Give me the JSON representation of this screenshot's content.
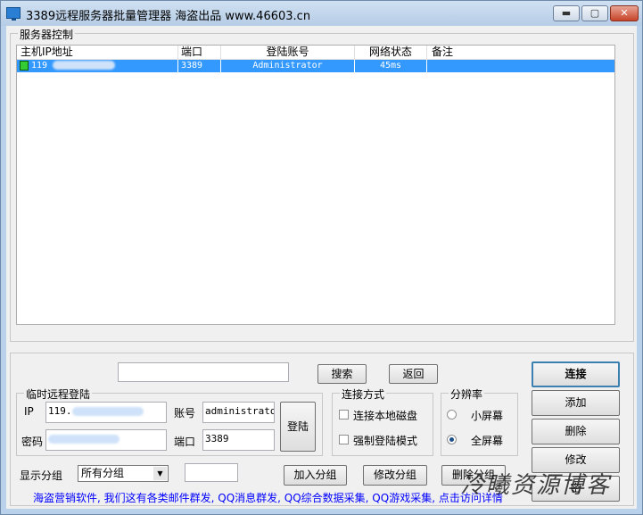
{
  "window": {
    "title": "3389远程服务器批量管理器 海盗出品   www.46603.cn",
    "min_glyph": "▬",
    "max_glyph": "▢",
    "close_glyph": "✕"
  },
  "server_group": {
    "label": "服务器控制",
    "columns": [
      "主机IP地址",
      "端口",
      "登陆账号",
      "网络状态",
      "备注"
    ],
    "rows": [
      {
        "ip": "119",
        "port": "3389",
        "account": "Administrator",
        "status": "45ms",
        "note": ""
      }
    ]
  },
  "search": {
    "input_value": "",
    "search_label": "搜索",
    "back_label": "返回"
  },
  "temp_login": {
    "label": "临时远程登陆",
    "ip_label": "IP",
    "ip_value": "119.",
    "password_label": "密码",
    "password_value": "",
    "account_label": "账号",
    "account_value": "administrator",
    "port_label": "端口",
    "port_value": "3389",
    "login_label": "登陆"
  },
  "connect_mode": {
    "label": "连接方式",
    "local_disk": "连接本地磁盘",
    "force_login": "强制登陆模式"
  },
  "resolution": {
    "label": "分辨率",
    "small": "小屏幕",
    "full": "全屏幕"
  },
  "groups": {
    "display_label": "显示分组",
    "selected": "所有分组",
    "input_value": "",
    "add_label": "加入分组",
    "edit_label": "修改分组",
    "delete_label": "删除分组"
  },
  "actions": {
    "connect": "连接",
    "add": "添加",
    "delete": "删除",
    "edit": "修改",
    "more": "密"
  },
  "footer": {
    "text": "海盗营销软件, 我们这有各类邮件群发, QQ消息群发, QQ综合数据采集, QQ游戏采集, 点击访问详情"
  },
  "watermark": "冷曦资源博客",
  "colors": {
    "selection": "#3399ff",
    "link": "#0000ff",
    "status_green": "#33cc33"
  }
}
